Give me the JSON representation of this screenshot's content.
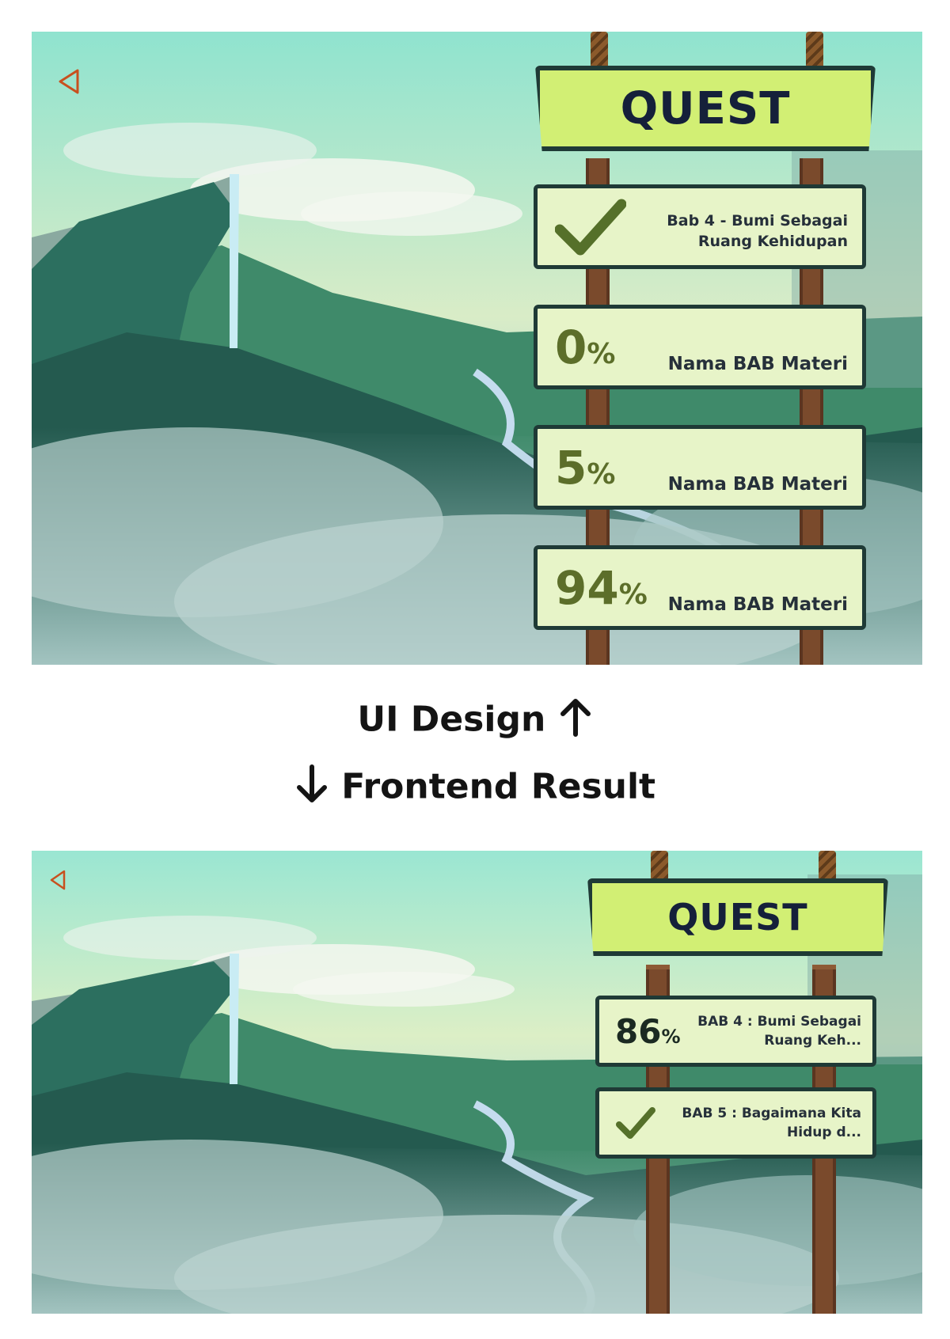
{
  "labels": {
    "design": "UI Design",
    "result": "Frontend Result"
  },
  "icons": {
    "back": "back-triangle-icon",
    "check": "check-icon",
    "arrow_up": "arrow-up-icon",
    "arrow_down": "arrow-down-icon"
  },
  "colors": {
    "board": "#d2ef74",
    "card": "#e7f4c8",
    "outline": "#1f3a36",
    "percent": "#5c6e2a",
    "back_icon": "#c8501e"
  },
  "design": {
    "board_title": "QUEST",
    "cards": [
      {
        "status": "done",
        "title_line1": "Bab 4 - Bumi Sebagai",
        "title_line2": "Ruang Kehidupan"
      },
      {
        "percent": "0",
        "percent_sign": "%",
        "title_line1": "Nama BAB Materi"
      },
      {
        "percent": "5",
        "percent_sign": "%",
        "title_line1": "Nama BAB Materi"
      },
      {
        "percent": "94",
        "percent_sign": "%",
        "title_line1": "Nama BAB Materi"
      }
    ]
  },
  "result": {
    "board_title": "QUEST",
    "cards": [
      {
        "percent": "86",
        "percent_sign": "%",
        "title_line1": "BAB 4 : Bumi Sebagai",
        "title_line2": "Ruang Keh..."
      },
      {
        "status": "done",
        "title_line1": "BAB 5 : Bagaimana Kita",
        "title_line2": "Hidup d..."
      }
    ]
  }
}
